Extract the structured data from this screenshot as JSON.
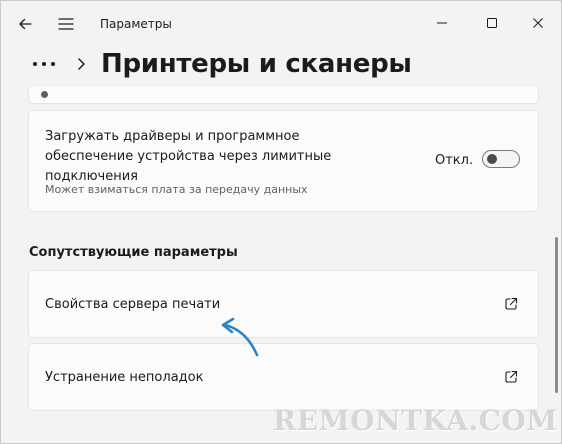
{
  "app": {
    "title": "Параметры"
  },
  "header": {
    "title": "Принтеры и сканеры"
  },
  "metered": {
    "label": "Загружать драйверы и программное обеспечение устройства через лимитные подключения",
    "description": "Может взиматься плата за передачу данных",
    "toggle_state_label": "Откл.",
    "toggle_on": false
  },
  "related": {
    "section_title": "Сопутствующие параметры",
    "items": [
      {
        "label": "Свойства сервера печати"
      },
      {
        "label": "Устранение неполадок"
      }
    ]
  },
  "watermark": "REMONTKA.COM",
  "colors": {
    "background": "#f3f3f3",
    "card": "#fbfbfb",
    "annotation_arrow": "#2a84c6"
  }
}
